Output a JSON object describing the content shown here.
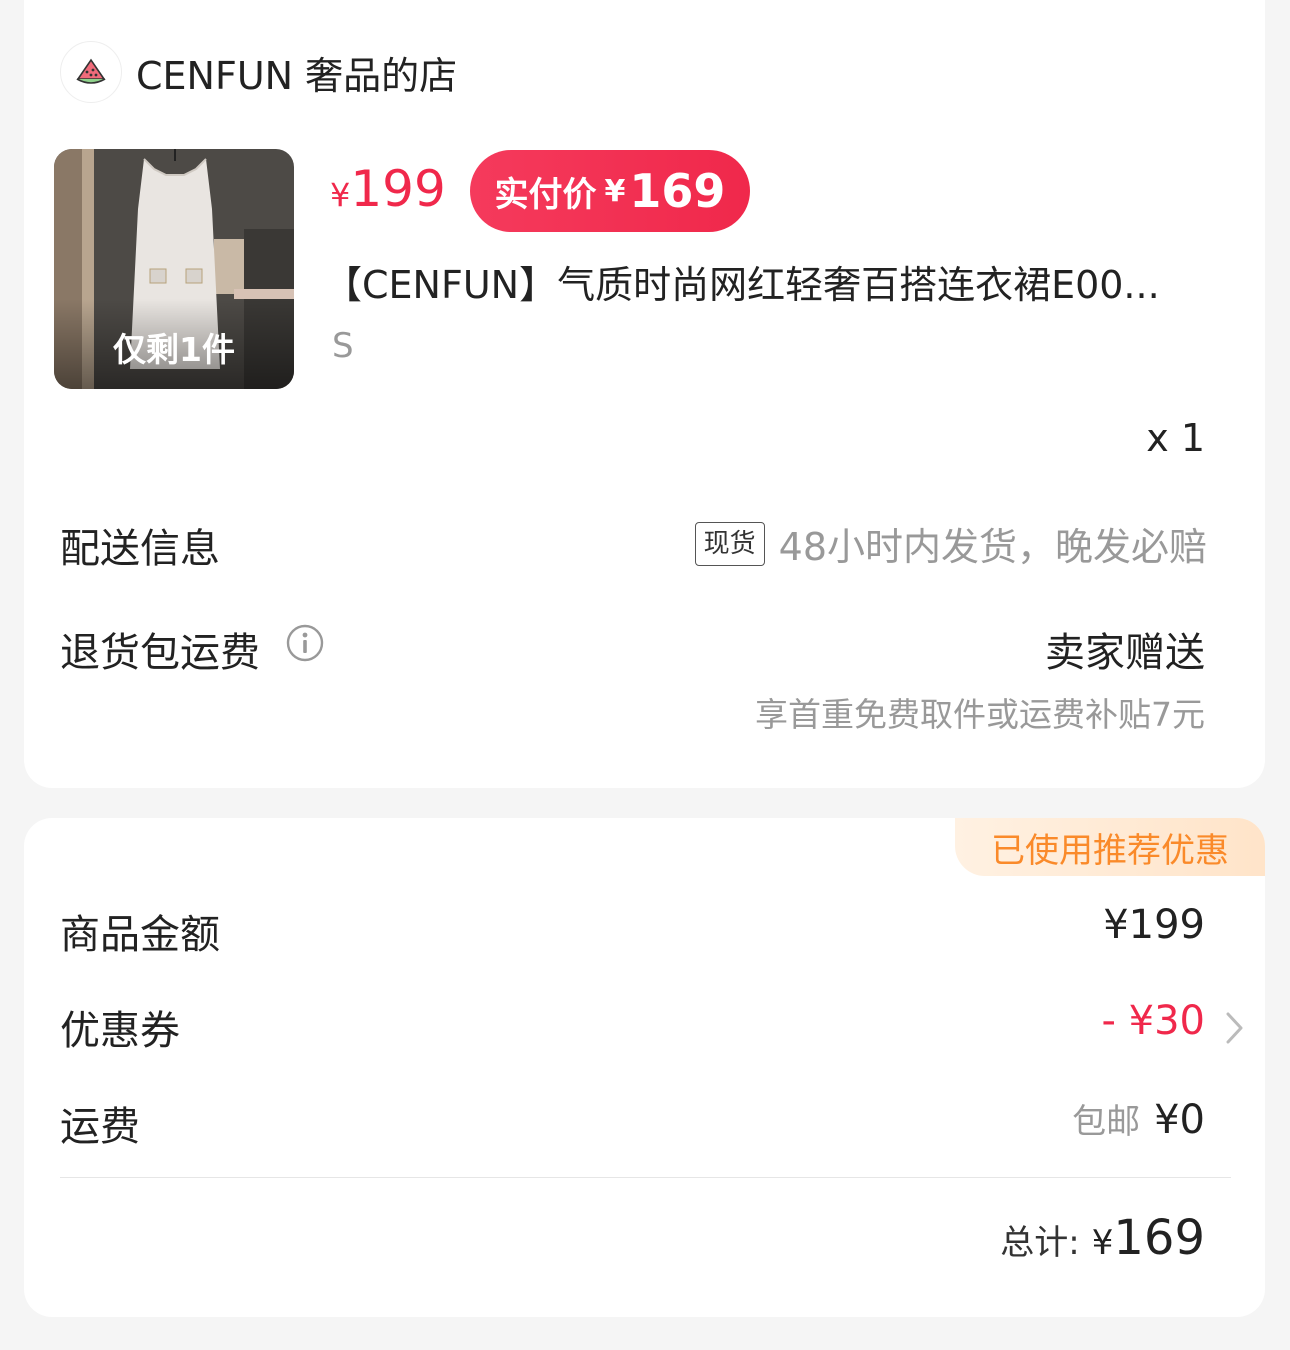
{
  "shop": {
    "name": "CENFUN 奢品的店",
    "avatar_icon": "watermelon-icon"
  },
  "product": {
    "stock_label": "仅剩1件",
    "price_symbol": "¥",
    "price": "199",
    "pay_label": "实付价",
    "pay_symbol": "¥",
    "pay_price": "169",
    "title": "【CENFUN】气质时尚网红轻奢百搭连衣裙E00...",
    "spec": "S",
    "quantity": "x 1"
  },
  "delivery": {
    "label": "配送信息",
    "tag": "现货",
    "text": "48小时内发货，晚发必赔"
  },
  "return_shipping": {
    "label": "退货包运费",
    "info_icon": "info-icon",
    "value": "卖家赠送",
    "subtext": "享首重免费取件或运费补贴7元"
  },
  "summary": {
    "badge": "已使用推荐优惠",
    "goods_label": "商品金额",
    "goods_amount": "¥199",
    "coupon_label": "优惠券",
    "coupon_amount": "- ¥30",
    "shipping_label": "运费",
    "shipping_free": "包邮",
    "shipping_amount": "¥0",
    "total_label": "总计:",
    "total_symbol": "¥",
    "total_amount": "169"
  },
  "colors": {
    "accent": "#f0284b",
    "badge_text": "#fa8a2a",
    "muted": "#999999"
  }
}
